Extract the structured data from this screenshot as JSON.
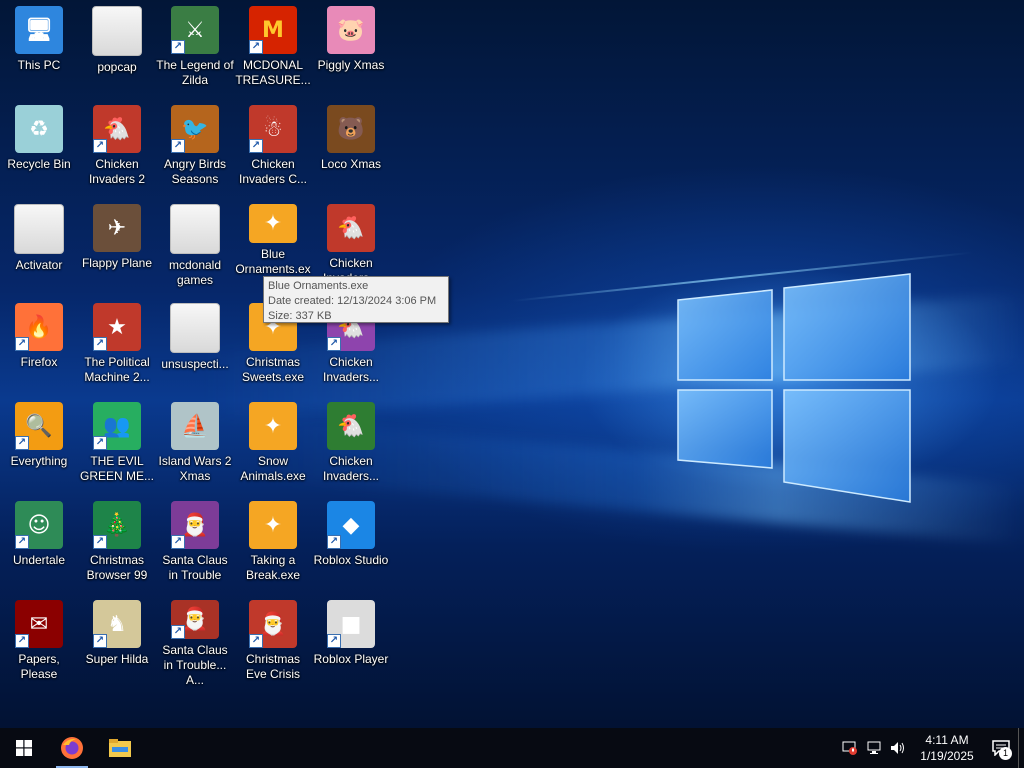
{
  "desktop": {
    "icons": [
      {
        "label": "This PC",
        "icon": "computer-icon",
        "shortcut": false,
        "color": "#2e86de"
      },
      {
        "label": "popcap",
        "icon": "folder-icon",
        "shortcut": false,
        "color": "#e6e6e6"
      },
      {
        "label": "The Legend of Zilda",
        "icon": "game-zilda-icon",
        "shortcut": true,
        "color": "#3a7d44"
      },
      {
        "label": "MCDONAL TREASURE...",
        "icon": "mcdonalds-icon",
        "shortcut": true,
        "color": "#d62300"
      },
      {
        "label": "Piggly Xmas",
        "icon": "pig-icon",
        "shortcut": false,
        "color": "#e88ab8"
      },
      {
        "label": "Recycle Bin",
        "icon": "recycle-bin-icon",
        "shortcut": false,
        "color": "#9ad0d8"
      },
      {
        "label": "Chicken Invaders 2",
        "icon": "chicken-icon",
        "shortcut": true,
        "color": "#c0392b"
      },
      {
        "label": "Angry Birds Seasons",
        "icon": "angry-birds-icon",
        "shortcut": true,
        "color": "#b5651d"
      },
      {
        "label": "Chicken Invaders C...",
        "icon": "chicken-snowman-icon",
        "shortcut": true,
        "color": "#c0392b"
      },
      {
        "label": "Loco Xmas",
        "icon": "bear-icon",
        "shortcut": false,
        "color": "#7a4a1f"
      },
      {
        "label": "Activator",
        "icon": "file-icon",
        "shortcut": false,
        "color": "#e6e6e6"
      },
      {
        "label": "Flappy Plane",
        "icon": "plane-icon",
        "shortcut": false,
        "color": "#6b4f3a"
      },
      {
        "label": "mcdonald games",
        "icon": "folder-icon",
        "shortcut": false,
        "color": "#e6e6e6"
      },
      {
        "label": "Blue Ornaments.exe",
        "icon": "ornament-exe-icon",
        "shortcut": false,
        "color": "#f5a623"
      },
      {
        "label": "Chicken Invaders...",
        "icon": "chicken-santa-icon",
        "shortcut": false,
        "color": "#c0392b"
      },
      {
        "label": "Firefox",
        "icon": "firefox-icon",
        "shortcut": true,
        "color": "#ff7139"
      },
      {
        "label": "The Political Machine 2...",
        "icon": "political-icon",
        "shortcut": true,
        "color": "#c0392b"
      },
      {
        "label": "unsuspecti...",
        "icon": "folder-icon",
        "shortcut": false,
        "color": "#e6e6e6"
      },
      {
        "label": "Christmas Sweets.exe",
        "icon": "sweets-exe-icon",
        "shortcut": false,
        "color": "#f5a623"
      },
      {
        "label": "Chicken Invaders...",
        "icon": "chicken-icon",
        "shortcut": true,
        "color": "#8e44ad"
      },
      {
        "label": "Everything",
        "icon": "search-everything-icon",
        "shortcut": true,
        "color": "#f39c12"
      },
      {
        "label": "THE EVIL GREEN ME...",
        "icon": "messenger-icon",
        "shortcut": true,
        "color": "#27ae60"
      },
      {
        "label": "Island Wars 2 Xmas",
        "icon": "island-icon",
        "shortcut": false,
        "color": "#b0c4c8"
      },
      {
        "label": "Snow Animals.exe",
        "icon": "snow-exe-icon",
        "shortcut": false,
        "color": "#f5a623"
      },
      {
        "label": "Chicken Invaders...",
        "icon": "chicken-icon",
        "shortcut": false,
        "color": "#2e7d32"
      },
      {
        "label": "Undertale",
        "icon": "undertale-icon",
        "shortcut": true,
        "color": "#2e8b57"
      },
      {
        "label": "Christmas Browser 99",
        "icon": "tree-icon",
        "shortcut": true,
        "color": "#1e8449"
      },
      {
        "label": "Santa Claus in Trouble",
        "icon": "santa-icon",
        "shortcut": true,
        "color": "#7d3c98"
      },
      {
        "label": "Taking a Break.exe",
        "icon": "break-exe-icon",
        "shortcut": false,
        "color": "#f5a623"
      },
      {
        "label": "Roblox Studio",
        "icon": "roblox-studio-icon",
        "shortcut": true,
        "color": "#1b86e5"
      },
      {
        "label": "Papers, Please",
        "icon": "papers-please-icon",
        "shortcut": true,
        "color": "#8b0000"
      },
      {
        "label": "Super Hilda",
        "icon": "hilda-icon",
        "shortcut": true,
        "color": "#d4c89a"
      },
      {
        "label": "Santa Claus in Trouble... A...",
        "icon": "santa-icon",
        "shortcut": true,
        "color": "#a93226"
      },
      {
        "label": "Christmas Eve Crisis",
        "icon": "santa-face-icon",
        "shortcut": true,
        "color": "#c0392b"
      },
      {
        "label": "Roblox Player",
        "icon": "roblox-icon",
        "shortcut": true,
        "color": "#dcdcdc"
      }
    ],
    "tooltip": {
      "name": "Blue Ornaments.exe",
      "created": "Date created: 12/13/2024 3:06 PM",
      "size": "Size: 337 KB"
    }
  },
  "taskbar": {
    "start_icon": "windows-logo-icon",
    "pinned": [
      {
        "icon": "firefox-icon",
        "active": true
      },
      {
        "icon": "file-explorer-icon",
        "active": false
      }
    ],
    "tray": {
      "icons": [
        "network-warning-icon",
        "network-icon",
        "volume-icon"
      ],
      "time": "4:11 AM",
      "date": "1/19/2025",
      "notification_count": "1"
    }
  }
}
